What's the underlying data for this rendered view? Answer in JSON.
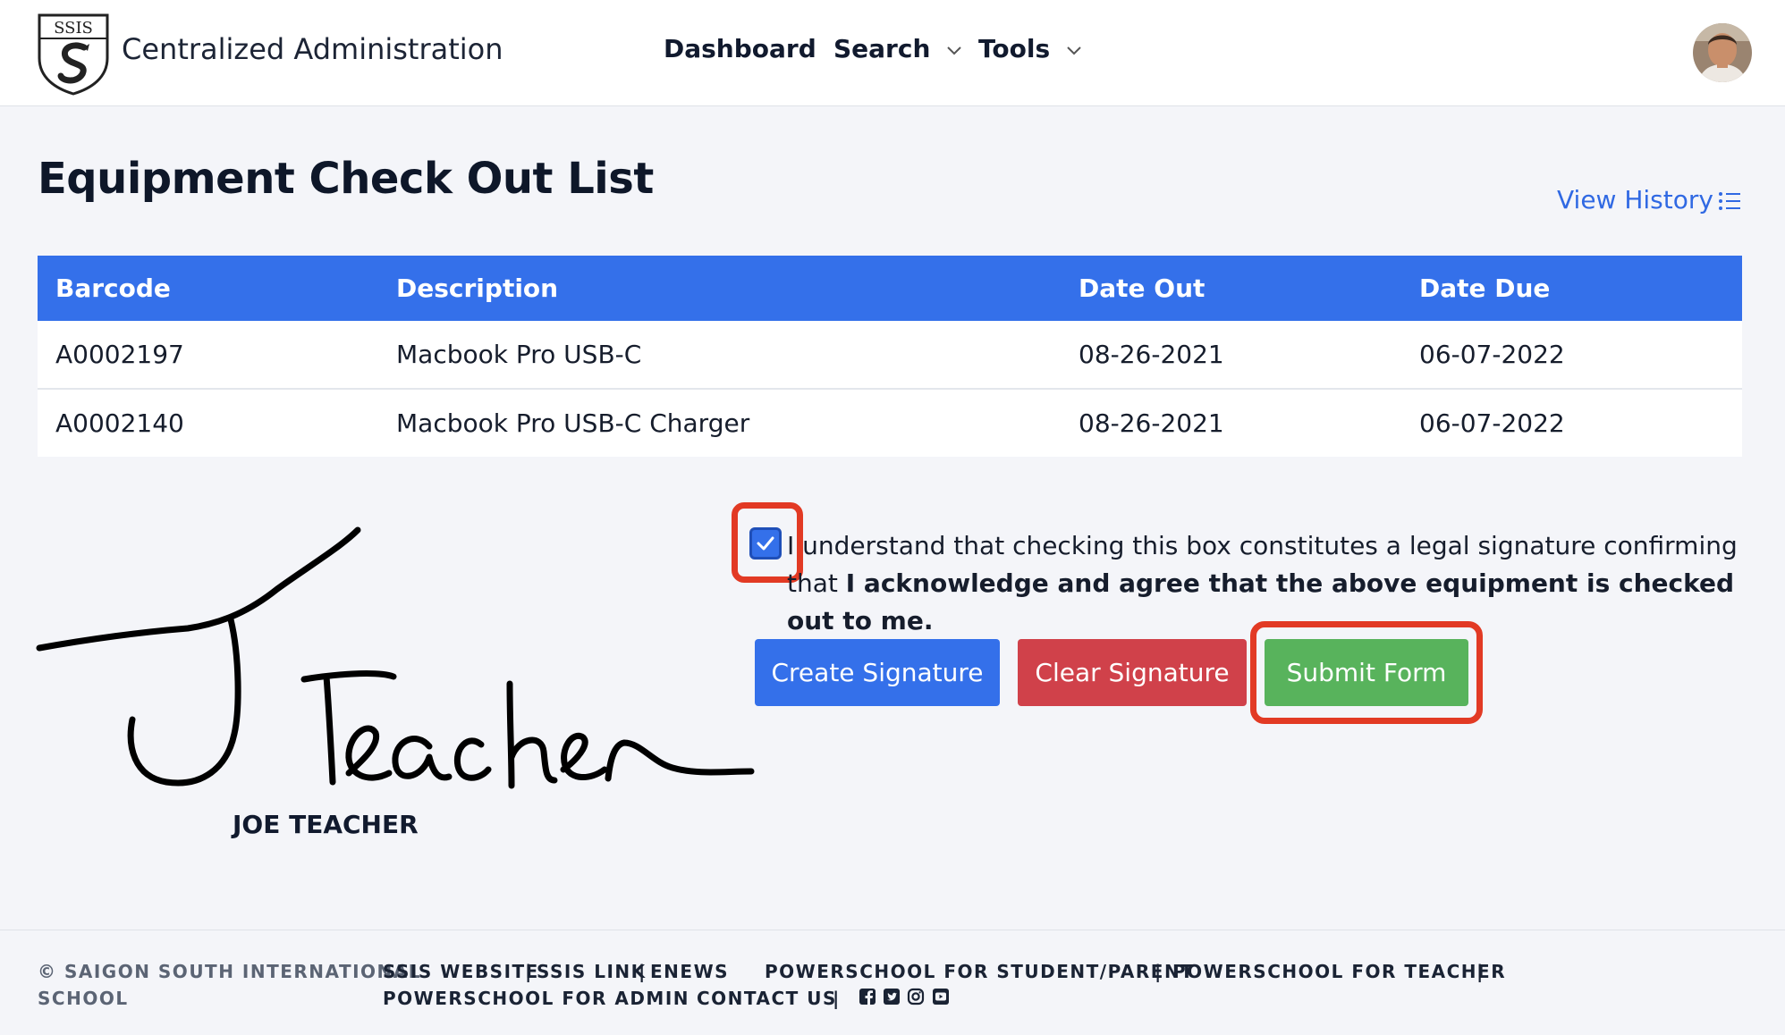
{
  "header": {
    "logo_text": "SSIS",
    "app_title": "Centralized Administration",
    "nav": {
      "dashboard": "Dashboard",
      "search": "Search",
      "tools": "Tools"
    }
  },
  "page": {
    "title": "Equipment Check Out List",
    "view_history": "View History"
  },
  "table": {
    "headers": {
      "barcode": "Barcode",
      "description": "Description",
      "date_out": "Date Out",
      "date_due": "Date Due"
    },
    "rows": [
      {
        "barcode": "A0002197",
        "description": "Macbook Pro USB-C",
        "date_out": "08-26-2021",
        "date_due": "06-07-2022"
      },
      {
        "barcode": "A0002140",
        "description": "Macbook Pro USB-C Charger",
        "date_out": "08-26-2021",
        "date_due": "06-07-2022"
      }
    ]
  },
  "signature": {
    "signer_name": "JOE TEACHER",
    "handwritten_text": "JTeacher"
  },
  "agreement": {
    "checked": true,
    "text_plain": "I understand that checking this box constitutes a legal signature confirming that ",
    "text_bold": "I acknowledge and agree that the above equipment is checked out to me."
  },
  "buttons": {
    "create_signature": "Create Signature",
    "clear_signature": "Clear Signature",
    "submit_form": "Submit Form"
  },
  "footer": {
    "copyright_line1": "© SAIGON SOUTH INTERNATIONAL",
    "copyright_line2": "SCHOOL",
    "ssis_website": "SSIS WEBSITE",
    "ssis_link": "SSIS LINK",
    "enews": "ENEWS",
    "powerschool_student_parent": "POWERSCHOOL FOR STUDENT/PARENT",
    "powerschool_teacher": "POWERSCHOOL FOR TEACHER",
    "powerschool_admin": "POWERSCHOOL FOR ADMIN",
    "contact_us": "CONTACT US",
    "separator": "|",
    "social_icons": [
      "facebook-icon",
      "twitter-icon",
      "instagram-icon",
      "youtube-icon"
    ]
  },
  "colors": {
    "primary": "#3470ea",
    "danger": "#d0414a",
    "success": "#58b35c",
    "highlight": "#e23a24",
    "link": "#3069e3"
  }
}
